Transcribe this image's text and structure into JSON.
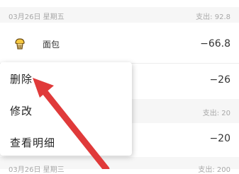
{
  "day1": {
    "date": "03月26日  星期五",
    "expense_label": "支出:",
    "expense_total": "92.8",
    "items": [
      {
        "icon": "bread-icon",
        "category": "面包",
        "amount": "−66.8"
      },
      {
        "amount": "−26"
      }
    ]
  },
  "day2": {
    "expense_label": "支出:",
    "expense_total": "20",
    "items": [
      {
        "amount": "−20"
      }
    ]
  },
  "day3": {
    "date": "03月26日  星期三",
    "expense_label": "支出:",
    "expense_total": "200"
  },
  "context_menu": {
    "items": [
      {
        "label": "删除"
      },
      {
        "label": "修改"
      },
      {
        "label": "查看明细"
      }
    ]
  },
  "colors": {
    "arrow": "#e03a3a",
    "icon_yellow": "#f7c93e",
    "text_gray": "#a8a8a8"
  }
}
